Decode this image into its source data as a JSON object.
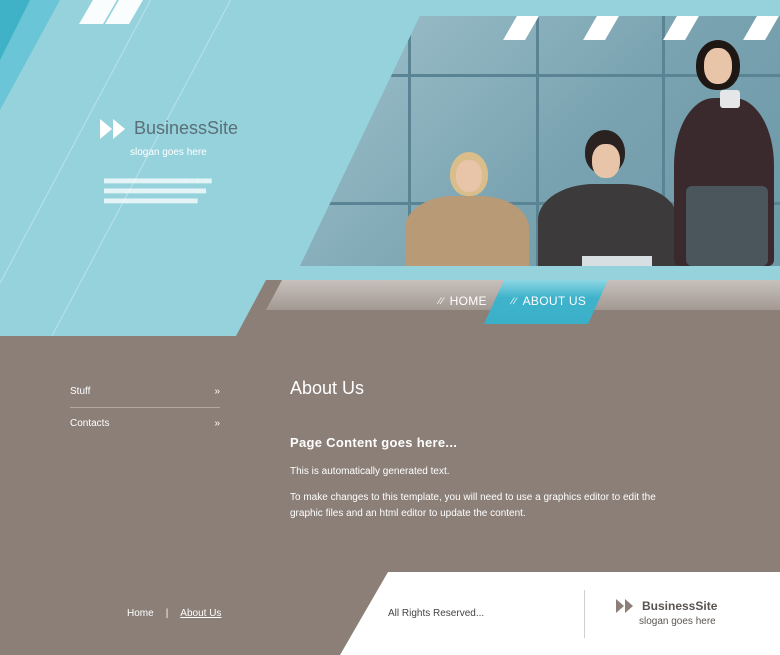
{
  "brand": {
    "name": "BusinessSite",
    "slogan": "slogan goes here"
  },
  "nav": {
    "items": [
      {
        "label": "HOME"
      },
      {
        "label": "ABOUT US"
      }
    ]
  },
  "sidebar": {
    "items": [
      {
        "label": "Stuff"
      },
      {
        "label": "Contacts"
      }
    ]
  },
  "content": {
    "title": "About Us",
    "subtitle": "Page Content goes here...",
    "paragraph1": "This is automatically generated text.",
    "paragraph2": "To make changes to this template, you will need to use a graphics editor to edit the graphic files and an html editor to update the content."
  },
  "footer": {
    "links": [
      {
        "label": "Home"
      },
      {
        "label": "About Us"
      }
    ],
    "separator": "|",
    "rights": "All Rights Reserved...",
    "brand": "BusinessSite",
    "slogan": "slogan goes here"
  },
  "icons": {
    "logo": "double-chevron-icon",
    "sidebar_arrow": "double-chevron-right-icon"
  },
  "colors": {
    "header_bg": "#96d2dc",
    "body_bg": "#8b7f78",
    "accent": "#3fb3cb",
    "footer_bg": "#ffffff"
  }
}
